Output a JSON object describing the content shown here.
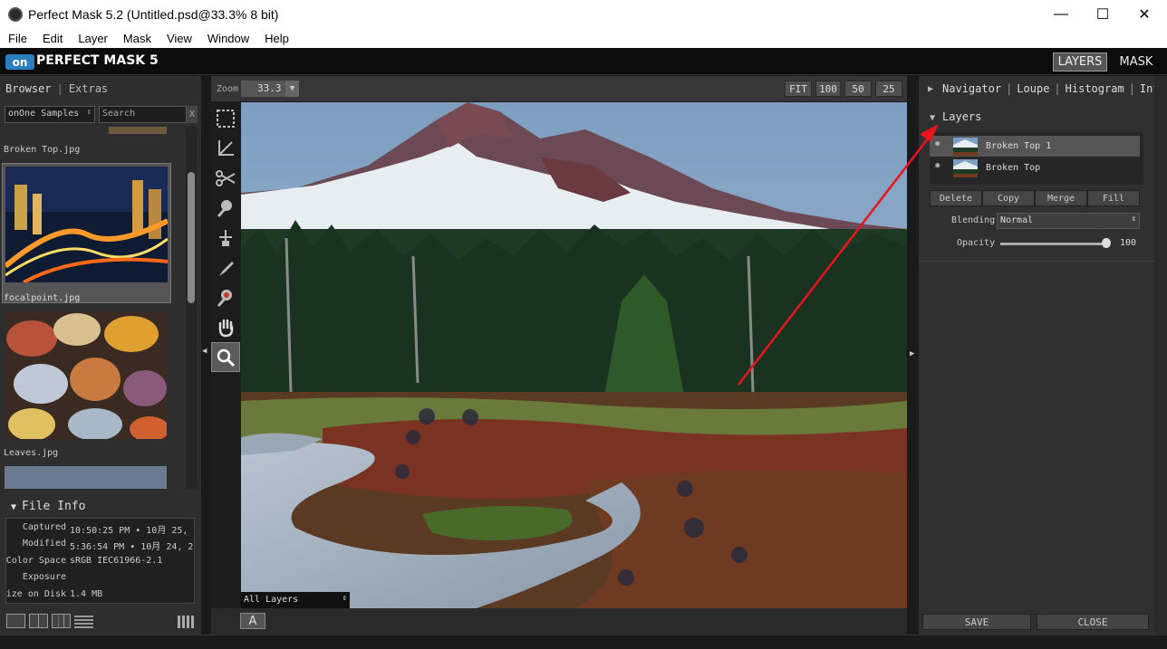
{
  "window": {
    "title": "Perfect Mask 5.2 (Untitled.psd@33.3% 8 bit)",
    "minimize": "—",
    "maximize": "☐",
    "close": "✕"
  },
  "menu": [
    "File",
    "Edit",
    "Layer",
    "Mask",
    "View",
    "Window",
    "Help"
  ],
  "brand": {
    "badge": "on",
    "name": "PERFECT MASK 5",
    "modes": [
      "LAYERS",
      "MASK"
    ],
    "active_mode": "LAYERS"
  },
  "left": {
    "tabs": [
      "Browser",
      "Extras"
    ],
    "source_select": "onOne Samples",
    "search_placeholder": "Search",
    "clear": "X",
    "thumbnails": [
      {
        "label": "Broken Top.jpg"
      },
      {
        "label": "focalpoint.jpg"
      },
      {
        "label": "Leaves.jpg"
      }
    ],
    "file_info": {
      "title": "File Info",
      "rows": [
        {
          "key": "Captured",
          "value": "10:50:25 PM • 10月 25,"
        },
        {
          "key": "Modified",
          "value": "5:36:54 PM • 10月 24, 2"
        },
        {
          "key": "Color Space",
          "value": "sRGB IEC61966-2.1"
        },
        {
          "key": "Exposure",
          "value": ""
        },
        {
          "key": "Size on Disk",
          "value": "1.4 MB"
        }
      ]
    }
  },
  "center": {
    "zoom_label": "Zoom",
    "zoom_value": "33.3",
    "zoom_buttons": [
      "FIT",
      "100",
      "50",
      "25"
    ],
    "layers_selector": "All Layers",
    "a_button": "A"
  },
  "right": {
    "nav_tabs": [
      "Navigator",
      "Loupe",
      "Histogram",
      "Info"
    ],
    "layers_title": "Layers",
    "layers": [
      {
        "name": "Broken Top 1",
        "selected": true
      },
      {
        "name": "Broken Top",
        "selected": false
      }
    ],
    "layer_buttons": [
      "Delete",
      "Copy",
      "Merge",
      "Fill"
    ],
    "blending_label": "Blending",
    "blending_value": "Normal",
    "opacity_label": "Opacity",
    "opacity_value": "100",
    "save": "SAVE",
    "close": "CLOSE"
  },
  "colors": {
    "accent_blue": "#2a7fc1",
    "annotation_arrow": "#e8141e",
    "panel_bg": "#2e2e2e"
  }
}
